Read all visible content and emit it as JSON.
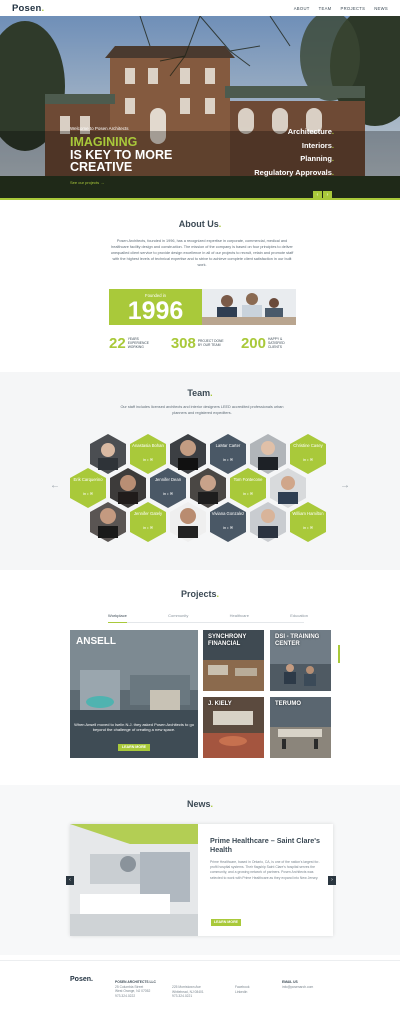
{
  "header": {
    "logo": "Posen",
    "logo_dot": ".",
    "nav": [
      "ABOUT",
      "TEAM",
      "PROJECTS",
      "NEWS"
    ]
  },
  "hero": {
    "welcome": "Welcome to Posen Architects",
    "headline_line1": "IMAGINING",
    "headline_line2": "IS KEY TO MORE",
    "headline_line3": "CREATIVE",
    "cta": "See our projects →",
    "services": [
      "Architecture",
      "Interiors",
      "Planning",
      "Regulatory Approvals"
    ],
    "prev_arrow": "‹",
    "next_arrow": "›"
  },
  "about": {
    "title": "About Us",
    "paragraph": "Posen Architects, founded in 1996, has a recognized expertise in corporate, commercial, medical and healthcare facility design and construction. The mission of the company is based on four principles to deliver unequalled client service to provide design excellence in all of our projects to recruit, retain and promote staff with the highest levels of technical expertise and to strive to achieve complete client satisfaction in our built work.",
    "founded_label": "Founded in",
    "founded_year": "1996",
    "stats": [
      {
        "value": "22",
        "label": "YEARS EXPERIENCE WORKING"
      },
      {
        "value": "308",
        "label": "PROJECT DONE BY OUR TEAM"
      },
      {
        "value": "200",
        "label": "HAPPY & SATISFIED CLIENTS"
      }
    ]
  },
  "team": {
    "title": "Team",
    "paragraph": "Our staff includes licensed architects and interior designers LEED accredited professionals urban planners and registered expediters.",
    "members": [
      {
        "name": "Anastasia Bohan"
      },
      {
        "name": "LaMar Carter"
      },
      {
        "name": "Christine Casey"
      },
      {
        "name": "Erik Carquerino"
      },
      {
        "name": "Jennifer Dean"
      },
      {
        "name": "Tom Fontecone"
      },
      {
        "name": "Jennifer Gately"
      },
      {
        "name": "Viviana Gonzalez"
      },
      {
        "name": "William Hamilton"
      }
    ],
    "social_icons": "in • ✉",
    "prev": "←",
    "next": "→"
  },
  "projects": {
    "title": "Projects",
    "tabs": [
      "Workplace",
      "Community",
      "Healthcare",
      "Education"
    ],
    "featured": {
      "name": "ANSELL",
      "description": "When Ansell moved to Iselin N.J. they asked Posen Architects to go beyond the challenge of creating a new space.",
      "button": "LEARN MORE"
    },
    "items": [
      {
        "name": "SYNCHRONY FINANCIAL"
      },
      {
        "name": "DSI - TRAINING CENTER"
      },
      {
        "name": "J. KIELY"
      },
      {
        "name": "TERUMO"
      }
    ]
  },
  "news": {
    "title": "News",
    "headline": "Prime Healthcare – Saint Clare's Health",
    "body": "Prime Healthcare, based in Ontario, CA, is one of the nation's largest for-profit hospital systems. Their flagship Saint Clare's hospital serves the community, and a growing network of partners. Posen Architects was selected to work with Prime Healthcare as they expand into New Jersey.",
    "button": "LEARN MORE",
    "prev": "‹",
    "next": "›"
  },
  "footer": {
    "logo": "Posen.",
    "col1_head": "POSEN ARCHITECTS LLC",
    "col1": [
      "25 Columbia Street",
      "West Orange, NJ 07052",
      "973.324.0222"
    ],
    "col2": [
      "225 Morristown Ave",
      "Whitehead, NJ 08401",
      "973.324.0221"
    ],
    "col3": [
      "Facebook",
      "Linkedin"
    ],
    "col4_head": "EMAIL US",
    "col4": [
      "info@posenarch.com"
    ]
  },
  "colors": {
    "accent": "#a9c93a",
    "dark": "#3c4a55",
    "hex_dark": "#4a5866"
  }
}
